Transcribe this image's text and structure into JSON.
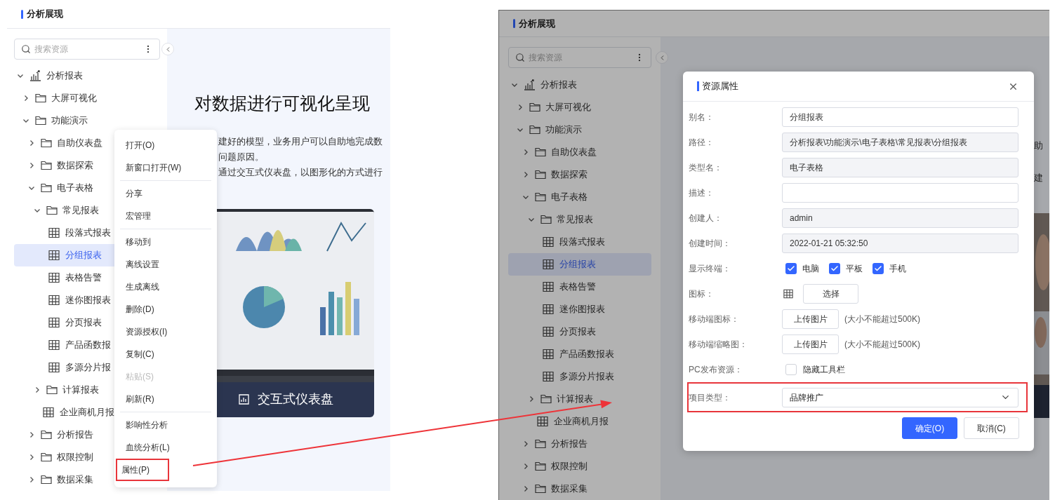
{
  "left": {
    "header": {
      "title": "分析展现"
    },
    "search": {
      "placeholder": "搜索资源"
    },
    "tree": [
      {
        "label": "分析报表",
        "kind": "root",
        "expanded": true,
        "selected": false,
        "children": [
          {
            "label": "大屏可视化",
            "kind": "folder",
            "expanded": false,
            "selected": false
          },
          {
            "label": "功能演示",
            "kind": "folder",
            "expanded": true,
            "selected": false,
            "children": [
              {
                "label": "自助仪表盘",
                "kind": "folder",
                "expanded": false,
                "selected": false
              },
              {
                "label": "数据探索",
                "kind": "folder",
                "expanded": false,
                "selected": false
              },
              {
                "label": "电子表格",
                "kind": "folder",
                "expanded": true,
                "selected": false,
                "children": [
                  {
                    "label": "常见报表",
                    "kind": "folder",
                    "expanded": true,
                    "selected": false,
                    "children": [
                      {
                        "label": "段落式报表",
                        "kind": "sheet",
                        "selected": false
                      },
                      {
                        "label": "分组报表",
                        "kind": "sheet",
                        "selected": true
                      },
                      {
                        "label": "表格告警",
                        "kind": "sheet",
                        "selected": false
                      },
                      {
                        "label": "迷你图报表",
                        "kind": "sheet",
                        "selected": false
                      },
                      {
                        "label": "分页报表",
                        "kind": "sheet",
                        "selected": false
                      },
                      {
                        "label": "产品函数报",
                        "kind": "sheet",
                        "selected": false
                      },
                      {
                        "label": "多源分片报",
                        "kind": "sheet",
                        "selected": false
                      }
                    ]
                  },
                  {
                    "label": "计算报表",
                    "kind": "folder",
                    "expanded": false,
                    "selected": false
                  },
                  {
                    "label": "企业商机月报",
                    "kind": "sheet",
                    "selected": false
                  }
                ]
              },
              {
                "label": "分析报告",
                "kind": "folder",
                "expanded": false,
                "selected": false
              },
              {
                "label": "权限控制",
                "kind": "folder",
                "expanded": false,
                "selected": false
              },
              {
                "label": "数据采集",
                "kind": "folder",
                "expanded": false,
                "selected": false
              }
            ]
          }
        ]
      }
    ],
    "content": {
      "title": "对数据进行可视化呈现",
      "paragraph": [
        "建好的模型，业务用户可以自助地完成数",
        "问题原因。",
        "通过交互式仪表盘，以图形化的方式进行"
      ],
      "card": {
        "caption": "交互式仪表盘"
      }
    },
    "context_menu": [
      {
        "kind": "item",
        "label": "打开(O)",
        "disabled": false
      },
      {
        "kind": "item",
        "label": "新窗口打开(W)",
        "disabled": false
      },
      {
        "kind": "divider"
      },
      {
        "kind": "item",
        "label": "分享",
        "disabled": false
      },
      {
        "kind": "item",
        "label": "宏管理",
        "disabled": false
      },
      {
        "kind": "divider"
      },
      {
        "kind": "item",
        "label": "移动到",
        "disabled": false
      },
      {
        "kind": "item",
        "label": "离线设置",
        "disabled": false
      },
      {
        "kind": "item",
        "label": "生成离线",
        "disabled": false
      },
      {
        "kind": "item",
        "label": "删除(D)",
        "disabled": false
      },
      {
        "kind": "item",
        "label": "资源授权(I)",
        "disabled": false
      },
      {
        "kind": "item",
        "label": "复制(C)",
        "disabled": false
      },
      {
        "kind": "item",
        "label": "粘贴(S)",
        "disabled": true
      },
      {
        "kind": "item",
        "label": "刷新(R)",
        "disabled": false
      },
      {
        "kind": "divider"
      },
      {
        "kind": "item",
        "label": "影响性分析",
        "disabled": false
      },
      {
        "kind": "item",
        "label": "血统分析(L)",
        "disabled": false
      },
      {
        "kind": "item",
        "label": "属性(P)",
        "disabled": false,
        "annotated": true
      }
    ]
  },
  "right": {
    "header": {
      "title": "分析展现"
    },
    "search": {
      "placeholder": "搜索资源"
    },
    "tree": [
      {
        "label": "分析报表",
        "kind": "root",
        "expanded": true,
        "selected": false,
        "children": [
          {
            "label": "大屏可视化",
            "kind": "folder",
            "expanded": false,
            "selected": false
          },
          {
            "label": "功能演示",
            "kind": "folder",
            "expanded": true,
            "selected": false,
            "children": [
              {
                "label": "自助仪表盘",
                "kind": "folder",
                "expanded": false,
                "selected": false
              },
              {
                "label": "数据探索",
                "kind": "folder",
                "expanded": false,
                "selected": false
              },
              {
                "label": "电子表格",
                "kind": "folder",
                "expanded": true,
                "selected": false,
                "children": [
                  {
                    "label": "常见报表",
                    "kind": "folder",
                    "expanded": true,
                    "selected": false,
                    "children": [
                      {
                        "label": "段落式报表",
                        "kind": "sheet",
                        "selected": false
                      },
                      {
                        "label": "分组报表",
                        "kind": "sheet",
                        "selected": true
                      },
                      {
                        "label": "表格告警",
                        "kind": "sheet",
                        "selected": false
                      },
                      {
                        "label": "迷你图报表",
                        "kind": "sheet",
                        "selected": false
                      },
                      {
                        "label": "分页报表",
                        "kind": "sheet",
                        "selected": false
                      },
                      {
                        "label": "产品函数报表",
                        "kind": "sheet",
                        "selected": false
                      },
                      {
                        "label": "多源分片报表",
                        "kind": "sheet",
                        "selected": false
                      }
                    ]
                  },
                  {
                    "label": "计算报表",
                    "kind": "folder",
                    "expanded": false,
                    "selected": false
                  },
                  {
                    "label": "企业商机月报",
                    "kind": "sheet",
                    "selected": false
                  }
                ]
              },
              {
                "label": "分析报告",
                "kind": "folder",
                "expanded": false,
                "selected": false
              },
              {
                "label": "权限控制",
                "kind": "folder",
                "expanded": false,
                "selected": false
              },
              {
                "label": "数据采集",
                "kind": "folder",
                "expanded": false,
                "selected": false
              }
            ]
          }
        ]
      }
    ],
    "content_fragments": [
      "助",
      "建"
    ],
    "dialog": {
      "title": "资源属性",
      "rows": [
        {
          "kind": "input",
          "label": "别名：",
          "value": "分组报表",
          "disabled": false
        },
        {
          "kind": "input",
          "label": "路径：",
          "value": "分析报表\\功能演示\\电子表格\\常见报表\\分组报表",
          "disabled": true
        },
        {
          "kind": "input",
          "label": "类型名：",
          "value": "电子表格",
          "disabled": true
        },
        {
          "kind": "input",
          "label": "描述：",
          "disabled": false
        },
        {
          "kind": "input",
          "label": "创建人：",
          "value": "admin",
          "disabled": true
        },
        {
          "kind": "input",
          "label": "创建时间：",
          "value": "2022-01-21 05:32:50",
          "disabled": true
        },
        {
          "kind": "checkboxes",
          "label": "显示终端：",
          "options": [
            {
              "label": "电脑",
              "checked": true
            },
            {
              "label": "平板",
              "checked": true
            },
            {
              "label": "手机",
              "checked": true
            }
          ]
        },
        {
          "kind": "icon",
          "label": "图标：",
          "button": "选择"
        },
        {
          "kind": "upload",
          "label": "移动端图标：",
          "button": "上传图片",
          "hint": "(大小不能超过500K)"
        },
        {
          "kind": "upload",
          "label": "移动端缩略图：",
          "button": "上传图片",
          "hint": "(大小不能超过500K)"
        },
        {
          "kind": "checkbox",
          "label": "PC发布资源：",
          "option": "隐藏工具栏",
          "checked": false
        },
        {
          "kind": "select",
          "label": "项目类型：",
          "value": "品牌推广",
          "annotated": true
        }
      ],
      "buttons": [
        {
          "label": "确定(O)",
          "kind": "primary"
        },
        {
          "label": "取消(C)",
          "kind": "default"
        }
      ]
    }
  }
}
